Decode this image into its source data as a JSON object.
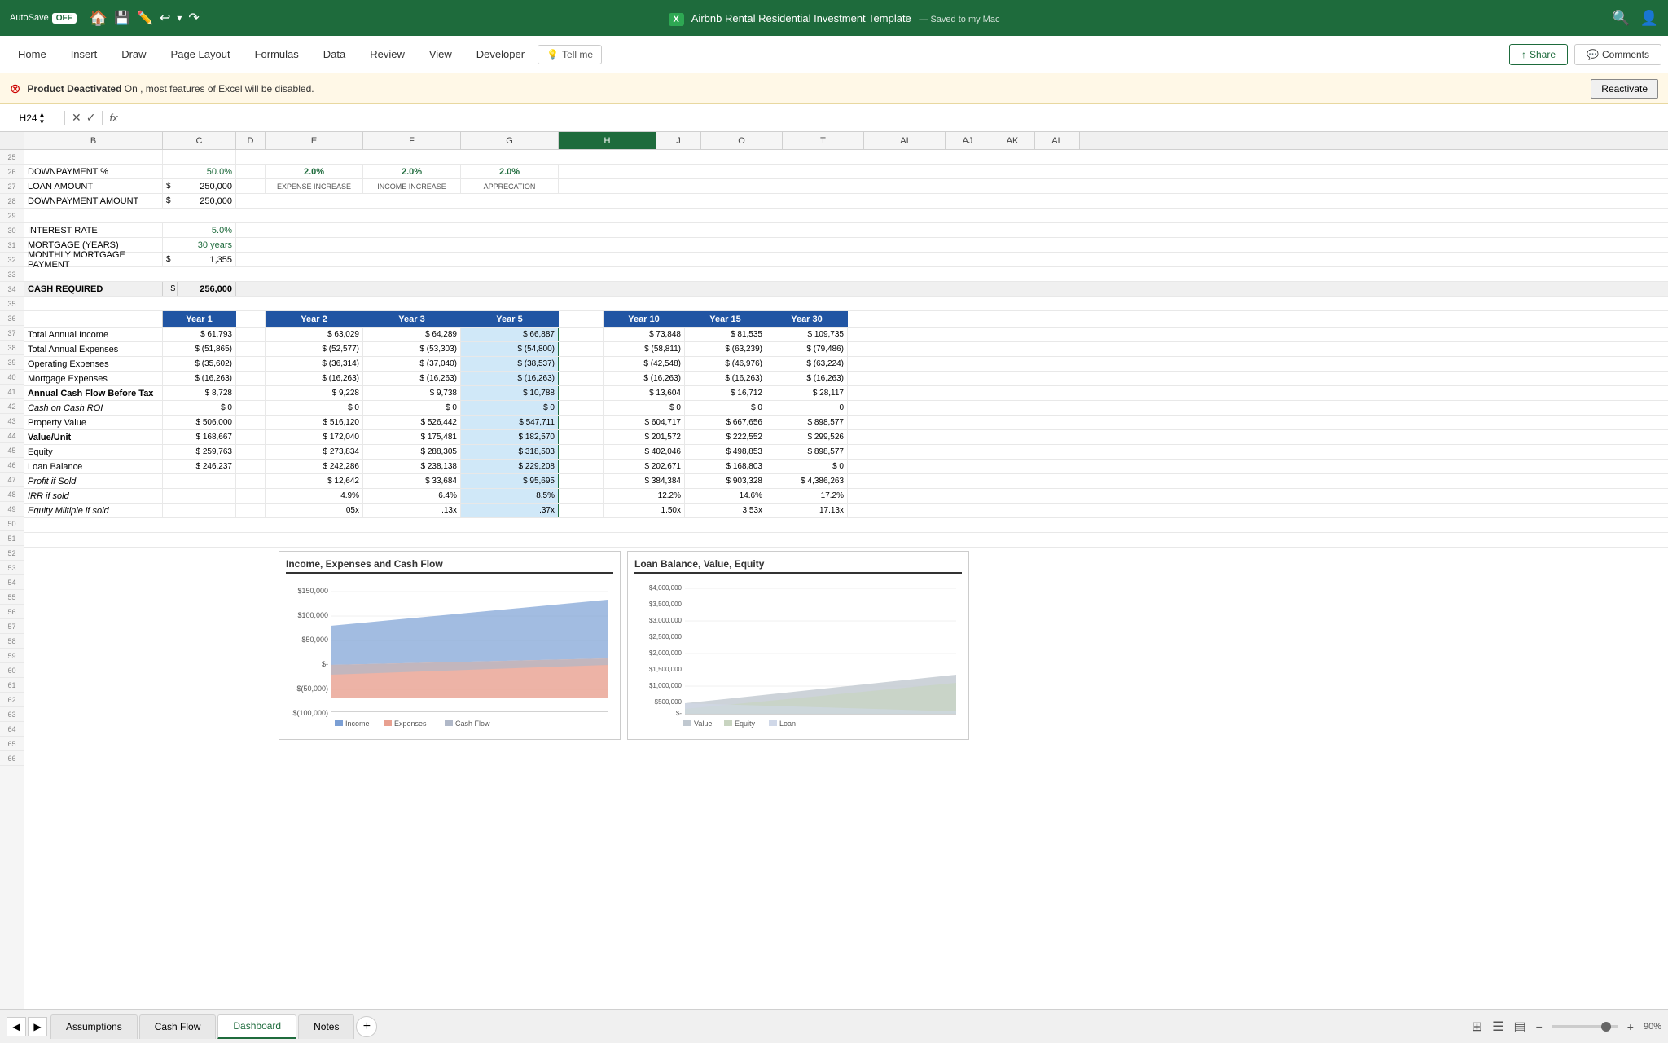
{
  "titleBar": {
    "autosave": "AutoSave",
    "autosaveState": "OFF",
    "title": "Airbnb Rental Residential Investment Template",
    "savedState": "— Saved to my Mac"
  },
  "ribbon": {
    "tabs": [
      "Home",
      "Insert",
      "Draw",
      "Page Layout",
      "Formulas",
      "Data",
      "Review",
      "View",
      "Developer"
    ],
    "tellMe": "Tell me",
    "shareLabel": "Share",
    "commentsLabel": "Comments"
  },
  "productBar": {
    "icon": "✕",
    "boldText": "Product Deactivated",
    "normalText": "On , most features of Excel will be disabled.",
    "reactivate": "Reactivate"
  },
  "formulaBar": {
    "cellRef": "H24",
    "fx": "fx"
  },
  "columns": {
    "headers": [
      "B",
      "C",
      "D",
      "E",
      "F",
      "G",
      "H",
      "J",
      "O",
      "T",
      "AI",
      "AJ",
      "AK",
      "AL"
    ],
    "widths": [
      160,
      80,
      40,
      110,
      110,
      110,
      110,
      60,
      90,
      90,
      90,
      60,
      60,
      60
    ]
  },
  "leftSection": {
    "rows": [
      {
        "label": "DOWNPAYMENT %",
        "value": "50.0%",
        "showDollar": false
      },
      {
        "label": "LOAN AMOUNT",
        "value": "250,000",
        "showDollar": true
      },
      {
        "label": "DOWNPAYMENT AMOUNT",
        "value": "250,000",
        "showDollar": true
      },
      {
        "label": "INTEREST RATE",
        "value": "5.0%",
        "showDollar": false
      },
      {
        "label": "MORTGAGE (YEARS)",
        "value": "30 years",
        "showDollar": false
      },
      {
        "label": "MONTHLY MORTGAGE PAYMENT",
        "value": "1,355",
        "showDollar": true
      }
    ],
    "cashRequired": {
      "label": "CASH REQUIRED",
      "value": "256,000"
    }
  },
  "pctLabels": [
    {
      "pct": "2.0%",
      "sub": "EXPENSE INCREASE"
    },
    {
      "pct": "2.0%",
      "sub": "INCOME INCREASE"
    },
    {
      "pct": "2.0%",
      "sub": "APPRECATION"
    }
  ],
  "tableHeaders": [
    "",
    "Year 1",
    "Year 2",
    "Year 3",
    "Year 5",
    "Year 10",
    "Year 15",
    "Year 30"
  ],
  "tableRows": [
    {
      "label": "Total Annual Income",
      "bold": false,
      "italic": false,
      "values": [
        "$ 61,793",
        "$ 63,029",
        "$ 64,289",
        "$ 66,887",
        "$ 73,848",
        "$ 81,535",
        "$ 109,735"
      ]
    },
    {
      "label": "Total Annual Expenses",
      "bold": false,
      "italic": false,
      "values": [
        "$ (51,865)",
        "$ (52,577)",
        "$ (53,303)",
        "$ (54,800)",
        "$ (58,811)",
        "$ (63,239)",
        "$ (79,486)"
      ]
    },
    {
      "label": "Operating Expenses",
      "bold": false,
      "italic": false,
      "values": [
        "$ (35,602)",
        "$ (36,314)",
        "$ (37,040)",
        "$ (38,537)",
        "$ (42,548)",
        "$ (46,976)",
        "$ (63,224)"
      ]
    },
    {
      "label": "Mortgage Expenses",
      "bold": false,
      "italic": false,
      "values": [
        "$ (16,263)",
        "$ (16,263)",
        "$ (16,263)",
        "$ (16,263)",
        "$ (16,263)",
        "$ (16,263)",
        "$ (16,263)"
      ]
    },
    {
      "label": "Annual Cash Flow Before Tax",
      "bold": true,
      "italic": false,
      "values": [
        "$ 8,728",
        "$ 9,228",
        "$ 9,738",
        "$ 10,788",
        "$ 13,604",
        "$ 16,712",
        "$ 28,117"
      ]
    },
    {
      "label": "Cash on Cash ROI",
      "bold": false,
      "italic": true,
      "values": [
        "$ 0",
        "$ 0",
        "$ 0",
        "$ 0",
        "$ 0",
        "$ 0",
        "0"
      ]
    },
    {
      "label": "Property Value",
      "bold": false,
      "italic": false,
      "values": [
        "$ 506,000",
        "$ 516,120",
        "$ 526,442",
        "$ 547,711",
        "$ 604,717",
        "$ 667,656",
        "$ 898,577"
      ]
    },
    {
      "label": "Value/Unit",
      "bold": true,
      "italic": false,
      "values": [
        "$ 168,667",
        "$ 172,040",
        "$ 175,481",
        "$ 182,570",
        "$ 201,572",
        "$ 222,552",
        "$ 299,526"
      ]
    },
    {
      "label": "Equity",
      "bold": false,
      "italic": false,
      "values": [
        "$ 259,763",
        "$ 273,834",
        "$ 288,305",
        "$ 318,503",
        "$ 402,046",
        "$ 498,853",
        "$ 898,577"
      ]
    },
    {
      "label": "Loan Balance",
      "bold": false,
      "italic": false,
      "values": [
        "$ 246,237",
        "$ 242,286",
        "$ 238,138",
        "$ 229,208",
        "$ 202,671",
        "$ 168,803",
        "$ 0"
      ]
    },
    {
      "label": "Profit if Sold",
      "bold": false,
      "italic": true,
      "values": [
        "",
        "$ 12,642",
        "$ 33,684",
        "$ 95,695",
        "$ 384,384",
        "$ 903,328",
        "$ 4,386,263"
      ]
    },
    {
      "label": "IRR if sold",
      "bold": false,
      "italic": true,
      "values": [
        "",
        "4.9%",
        "6.4%",
        "8.5%",
        "12.2%",
        "14.6%",
        "17.2%"
      ]
    },
    {
      "label": "Equity Miltiple if sold",
      "bold": false,
      "italic": true,
      "values": [
        "",
        ".05x",
        ".13x",
        ".37x",
        "1.50x",
        "3.53x",
        "17.13x"
      ]
    }
  ],
  "chart1": {
    "title": "Income, Expenses and Cash Flow",
    "legend": [
      "Income",
      "Expenses",
      "Cash Flow"
    ],
    "colors": [
      "#7b9fd4",
      "#e8a090",
      "#b0b8c8"
    ],
    "yLabels": [
      "$150,000",
      "$100,000",
      "$50,000",
      "$-",
      "$(50,000)",
      "$(100,000)"
    ]
  },
  "chart2": {
    "title": "Loan Balance, Value, Equity",
    "legend": [
      "Value",
      "Equity",
      "Loan"
    ],
    "colors": [
      "#b0b8c8",
      "#c8d4c0",
      "#d0d8e0"
    ],
    "yLabels": [
      "$4,000,000",
      "$3,500,000",
      "$3,000,000",
      "$2,500,000",
      "$2,000,000",
      "$1,500,000",
      "$1,000,000",
      "$500,000",
      "$-"
    ]
  },
  "sheets": [
    {
      "name": "Assumptions",
      "active": false
    },
    {
      "name": "Cash Flow",
      "active": false
    },
    {
      "name": "Dashboard",
      "active": true
    },
    {
      "name": "Notes",
      "active": false
    }
  ],
  "statusBar": {
    "viewIcons": [
      "grid",
      "page",
      "preview"
    ],
    "zoom": "90%"
  }
}
